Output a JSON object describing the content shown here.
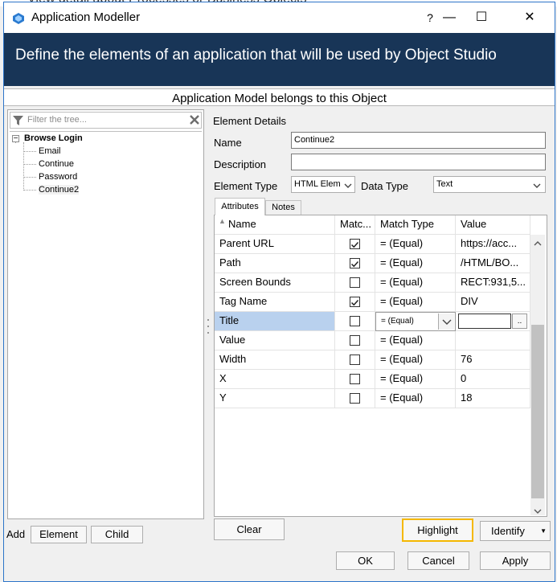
{
  "background_title": "View detail about Processes or Business Objects",
  "window": {
    "title": "Application Modeller",
    "help_label": "?",
    "minimize_label": "—",
    "maximize_label": "☐",
    "close_label": "✕",
    "icon": "application-modeller-icon",
    "border_color": "#2c74c9"
  },
  "header": {
    "text": "Define the elements of an application that will be used by Object Studio",
    "bg_color": "#183557"
  },
  "model_bar": {
    "text": "Application Model belongs to this Object"
  },
  "tree": {
    "filter_placeholder": "Filter the tree...",
    "root": {
      "expander": "−",
      "label": "Browse Login"
    },
    "children": [
      "Email",
      "Continue",
      "Password",
      "Continue2"
    ],
    "selected": "Continue2"
  },
  "left_buttons": {
    "add_label": "Add",
    "element_label": "Element",
    "child_label": "Child"
  },
  "details": {
    "section_label": "Element Details",
    "name_label": "Name",
    "name_value": "Continue2",
    "description_label": "Description",
    "description_value": "",
    "element_type_label": "Element Type",
    "element_type_value": "HTML Elem",
    "data_type_label": "Data Type",
    "data_type_value": "Text"
  },
  "tabs": [
    "Attributes",
    "Notes"
  ],
  "grid": {
    "columns": [
      "Name",
      "Matc...",
      "Match Type",
      "Value"
    ],
    "rows": [
      {
        "name": "Parent URL",
        "checked": true,
        "match": "=  (Equal)",
        "value": "https://acc..."
      },
      {
        "name": "Path",
        "checked": true,
        "match": "=  (Equal)",
        "value": "/HTML/BO..."
      },
      {
        "name": "Screen Bounds",
        "checked": false,
        "match": "=  (Equal)",
        "value": "RECT:931,5..."
      },
      {
        "name": "Tag Name",
        "checked": true,
        "match": "=  (Equal)",
        "value": "DIV"
      },
      {
        "name": "Title",
        "checked": false,
        "match": "=  (Equal)",
        "value": ""
      },
      {
        "name": "Value",
        "checked": false,
        "match": "=  (Equal)",
        "value": ""
      },
      {
        "name": "Width",
        "checked": false,
        "match": "=  (Equal)",
        "value": "76"
      },
      {
        "name": "X",
        "checked": false,
        "match": "=  (Equal)",
        "value": "0"
      },
      {
        "name": "Y",
        "checked": false,
        "match": "=  (Equal)",
        "value": "18"
      }
    ],
    "editing_row": 4,
    "ellipsis_label": "..",
    "selected_row_color": "#b9d1ee"
  },
  "buttons": {
    "clear": "Clear",
    "highlight": "Highlight",
    "identify": "Identify",
    "ok": "OK",
    "cancel": "Cancel",
    "apply": "Apply",
    "highlight_border_color": "#f5b800"
  }
}
